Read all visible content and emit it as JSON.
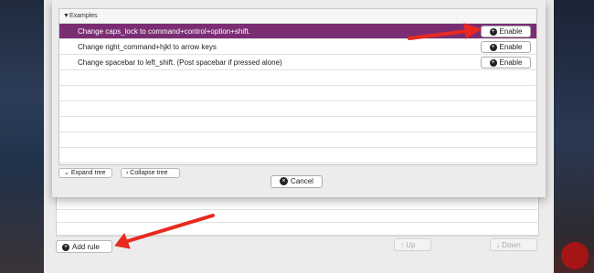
{
  "sheet": {
    "group_label": "Examples",
    "rules": [
      {
        "label": "Change caps_lock to command+control+option+shift.",
        "button": "Enable",
        "selected": true
      },
      {
        "label": "Change right_command+hjkl to arrow keys",
        "button": "Enable",
        "selected": false
      },
      {
        "label": "Change spacebar to left_shift. (Post spacebar if pressed alone)",
        "button": "Enable",
        "selected": false
      }
    ],
    "expand_label": "Expand tree",
    "collapse_label": "Collapse tree",
    "cancel_label": "Cancel"
  },
  "prefs": {
    "add_rule_label": "Add rule",
    "up_label": "Up",
    "down_label": "Down"
  },
  "colors": {
    "selection": "#7b2d74",
    "arrow": "#e8291f"
  }
}
